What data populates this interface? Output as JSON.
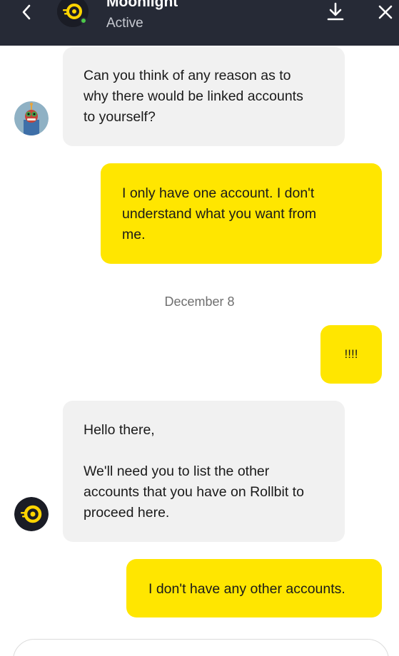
{
  "header": {
    "name": "Moonlight",
    "status": "Active"
  },
  "messages": [
    {
      "direction": "incoming",
      "text": "Can you think of any reason as to\nwhy there would be linked accounts\nto yourself?"
    },
    {
      "direction": "outgoing",
      "text": "I only have one account. I don't\nunderstand what you want from\nme."
    },
    {
      "direction": "outgoing",
      "text": "!!!!"
    },
    {
      "direction": "incoming",
      "text": "Hello there,\n\nWe'll need you to list the other\naccounts that you have on Rollbit to\nproceed here."
    },
    {
      "direction": "outgoing",
      "text": "I don't have any other accounts."
    }
  ],
  "date_separator": "December 8",
  "colors": {
    "header_bg": "#262a36",
    "incoming_bg": "#f1f1f1",
    "outgoing_bg": "#ffe600",
    "online": "#4cc94a"
  },
  "icons": [
    "back-icon",
    "brand-logo-icon",
    "download-icon",
    "close-icon",
    "user-avatar-icon",
    "agent-avatar-icon"
  ]
}
